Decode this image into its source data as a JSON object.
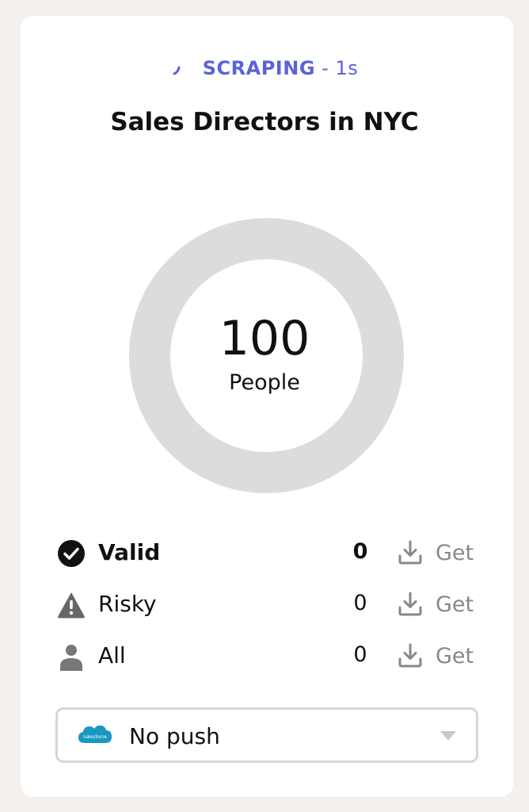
{
  "status": {
    "state": "SCRAPING",
    "elapsed": " - 1s",
    "color": "#5b63d8"
  },
  "title": "Sales Directors in NYC",
  "summary": {
    "count": "100",
    "label": "People"
  },
  "rows": [
    {
      "label": "Valid",
      "value": "0",
      "action": "Get",
      "icon": "check-circle-icon"
    },
    {
      "label": "Risky",
      "value": "0",
      "action": "Get",
      "icon": "warning-triangle-icon"
    },
    {
      "label": "All",
      "value": "0",
      "action": "Get",
      "icon": "person-icon"
    }
  ],
  "push": {
    "selected": "No push",
    "logo_text": "salesforce",
    "logo_color": "#1798c1"
  }
}
